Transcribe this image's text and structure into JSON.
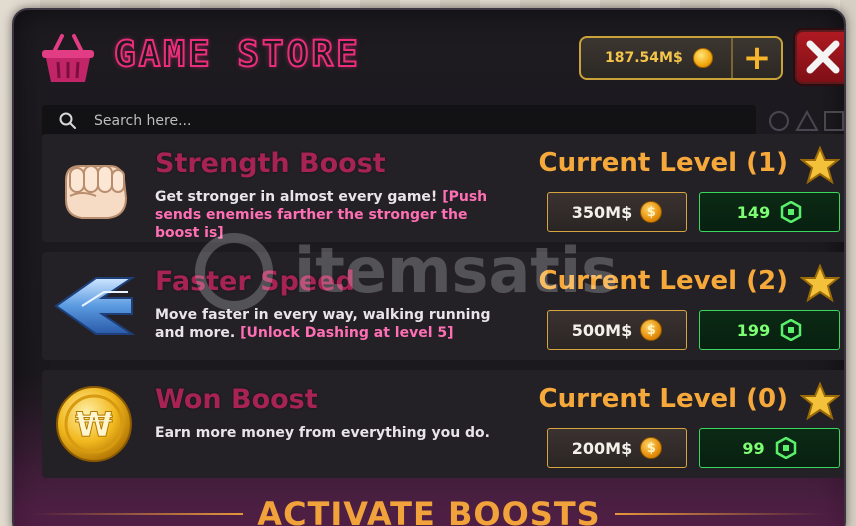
{
  "header": {
    "title": "GAME STORE",
    "balance": "187.54M$",
    "add_label": "+",
    "close_label": "✕"
  },
  "search": {
    "placeholder": "Search here..."
  },
  "items": [
    {
      "name": "Strength Boost",
      "description": "Get stronger in almost every game!",
      "extra": "[Push sends enemies farther the stronger the boost is]",
      "level": "Current Level (1)",
      "price": "350M$",
      "robux": "149",
      "icon": "fist-icon"
    },
    {
      "name": "Faster Speed",
      "description": "Move faster in every way, walking running and more.",
      "extra": "[Unlock Dashing at level 5]",
      "level": "Current Level (2)",
      "price": "500M$",
      "robux": "199",
      "icon": "speed-arrows-icon"
    },
    {
      "name": "Won Boost",
      "description": "Earn more money from everything you do.",
      "extra": "",
      "level": "Current Level (0)",
      "price": "200M$",
      "robux": "99",
      "icon": "won-coin-icon"
    }
  ],
  "coin_symbol": "$",
  "won_symbol": "₩",
  "watermark": "itemsatis",
  "footer": {
    "activate_label": "ACTIVATE BOOSTS"
  },
  "colors": {
    "title_pink": "#ec2d7b",
    "item_name": "#a82355",
    "level_orange": "#f6a93a",
    "robux_green": "#7dff74",
    "gold_border": "#d7a53f"
  }
}
